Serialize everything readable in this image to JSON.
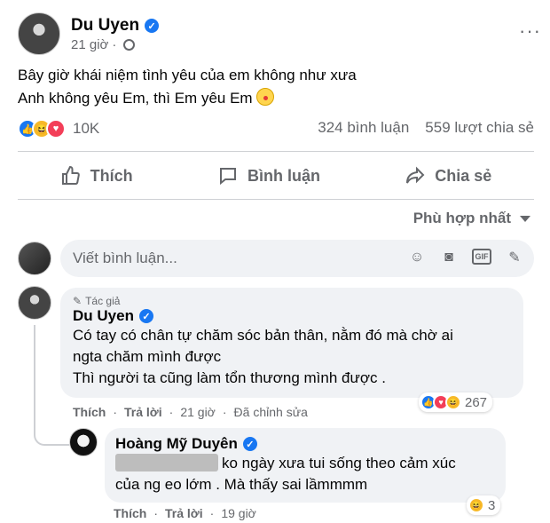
{
  "post": {
    "author": "Du Uyen",
    "time": "21 giờ",
    "more_label": "···",
    "text_line1": "Bây giờ khái niệm tình yêu của em không như xưa",
    "text_line2": "Anh không yêu Em, thì Em yêu Em",
    "reaction_count": "10K",
    "comments_count": "324 bình luận",
    "shares_count": "559 lượt chia sẻ"
  },
  "actions": {
    "like": "Thích",
    "comment": "Bình luận",
    "share": "Chia sẻ"
  },
  "sort_label": "Phù hợp nhất",
  "composer": {
    "placeholder": "Viết bình luận...",
    "gif_label": "GIF"
  },
  "comments": [
    {
      "badge": "Tác giả",
      "author": "Du Uyen",
      "line1": "Có tay có chân tự chăm sóc bản thân, nằm đó mà chờ ai",
      "line2": "ngta chăm mình được",
      "line3": "Thì người ta cũng làm tổn thương mình được .",
      "like": "Thích",
      "reply": "Trả lời",
      "time": "21 giờ",
      "edited": "Đã chỉnh sửa",
      "reactions": "267"
    },
    {
      "author": "Hoàng Mỹ Duyên",
      "line1": "ko ngày xưa tui sống theo cảm xúc",
      "line2": "của ng eo lớm . Mà thấy sai lầmmmm",
      "like": "Thích",
      "reply": "Trả lời",
      "time": "19 giờ",
      "reactions": "3"
    }
  ],
  "colors": {
    "brand_blue": "#1877f2",
    "secondary_text": "#65676b",
    "bubble_bg": "#f0f2f5",
    "love_red": "#f33e58",
    "haha_yellow": "#f7b928"
  },
  "icons": [
    "verified-icon",
    "globe-icon",
    "more-icon",
    "like-icon",
    "comment-icon",
    "share-icon",
    "smile-icon",
    "camera-icon",
    "gif-icon",
    "sticker-icon",
    "pencil-icon",
    "clown-emoji"
  ]
}
